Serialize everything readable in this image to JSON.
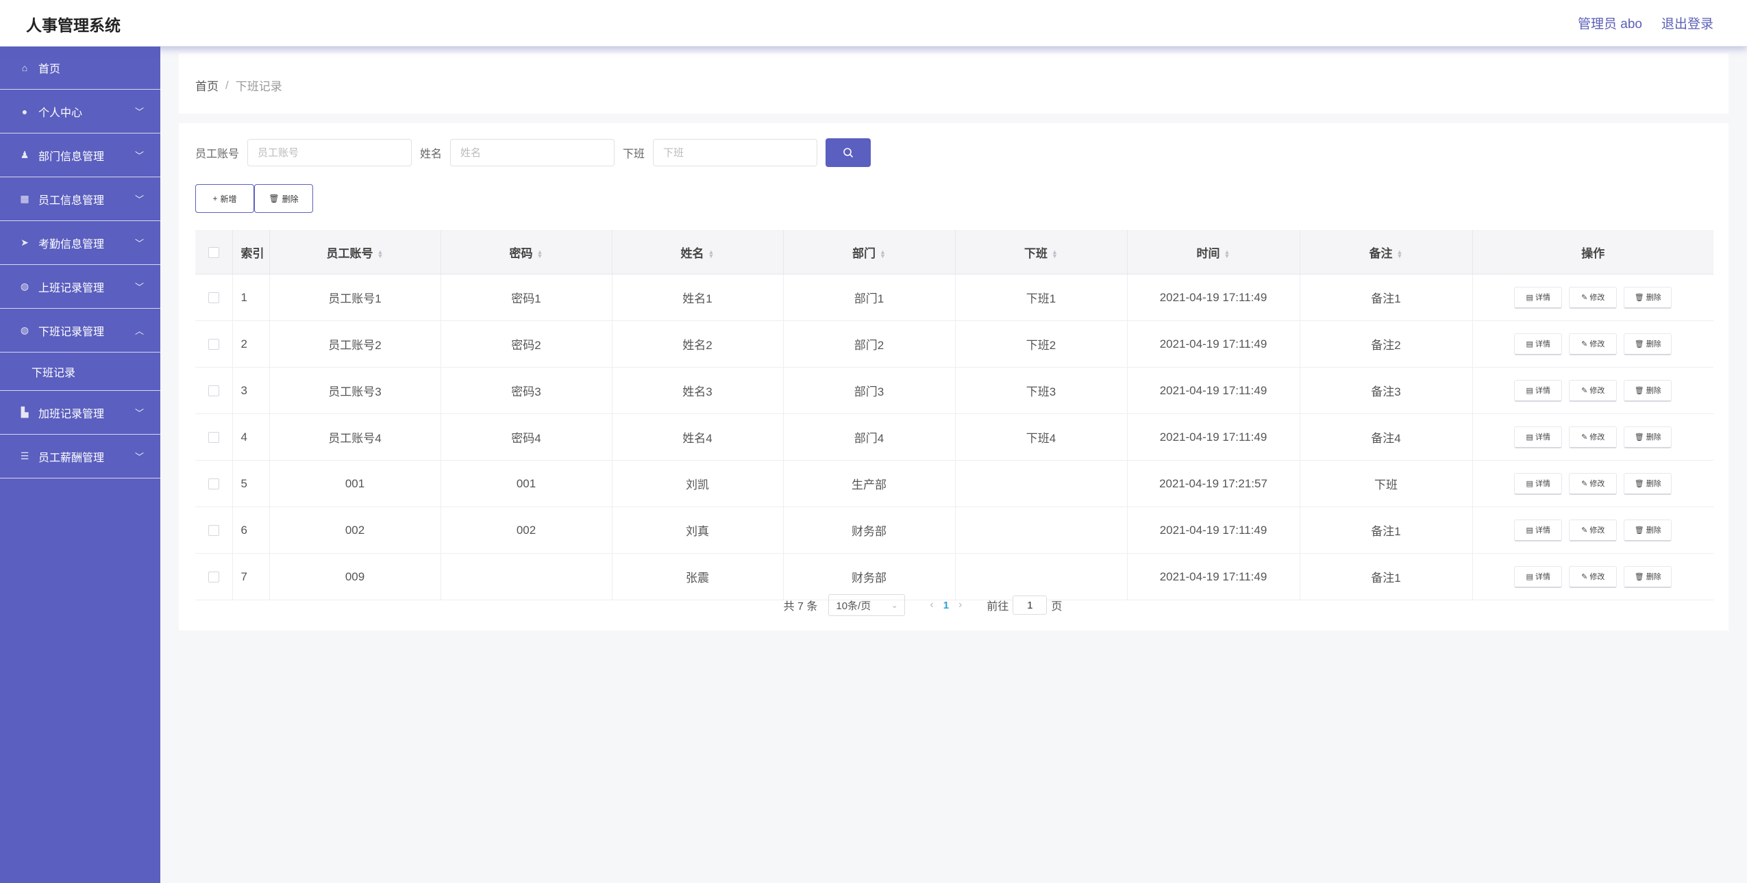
{
  "header": {
    "title": "人事管理系统",
    "user_label": "管理员 abo",
    "logout_label": "退出登录"
  },
  "sidebar": {
    "items": [
      {
        "label": "首页",
        "icon": "home-icon",
        "glyph": "⌂",
        "expandable": false
      },
      {
        "label": "个人中心",
        "icon": "user-icon",
        "glyph": "●",
        "expandable": true
      },
      {
        "label": "部门信息管理",
        "icon": "person-stand-icon",
        "glyph": "♟",
        "expandable": true
      },
      {
        "label": "员工信息管理",
        "icon": "grid-icon",
        "glyph": "▦",
        "expandable": true
      },
      {
        "label": "考勤信息管理",
        "icon": "send-icon",
        "glyph": "➤",
        "expandable": true
      },
      {
        "label": "上班记录管理",
        "icon": "microphone-icon",
        "glyph": "◍",
        "expandable": true
      },
      {
        "label": "下班记录管理",
        "icon": "microphone-icon",
        "glyph": "◍",
        "expandable": true,
        "expanded": true,
        "sub": "下班记录"
      },
      {
        "label": "加班记录管理",
        "icon": "thumbs-up-icon",
        "glyph": "▙",
        "expandable": true
      },
      {
        "label": "员工薪酬管理",
        "icon": "list-icon",
        "glyph": "☰",
        "expandable": true
      }
    ]
  },
  "breadcrumb": {
    "home": "首页",
    "separator": "/",
    "current": "下班记录"
  },
  "search": {
    "account_label": "员工账号",
    "account_placeholder": "员工账号",
    "name_label": "姓名",
    "name_placeholder": "姓名",
    "offwork_label": "下班",
    "offwork_placeholder": "下班"
  },
  "actions": {
    "add_label": "新增",
    "delete_label": "删除"
  },
  "table": {
    "columns": [
      "索引",
      "员工账号",
      "密码",
      "姓名",
      "部门",
      "下班",
      "时间",
      "备注",
      "操作"
    ],
    "rows": [
      {
        "index": "1",
        "account": "员工账号1",
        "password": "密码1",
        "name": "姓名1",
        "dept": "部门1",
        "offwork": "下班1",
        "time": "2021-04-19 17:11:49",
        "note": "备注1"
      },
      {
        "index": "2",
        "account": "员工账号2",
        "password": "密码2",
        "name": "姓名2",
        "dept": "部门2",
        "offwork": "下班2",
        "time": "2021-04-19 17:11:49",
        "note": "备注2"
      },
      {
        "index": "3",
        "account": "员工账号3",
        "password": "密码3",
        "name": "姓名3",
        "dept": "部门3",
        "offwork": "下班3",
        "time": "2021-04-19 17:11:49",
        "note": "备注3"
      },
      {
        "index": "4",
        "account": "员工账号4",
        "password": "密码4",
        "name": "姓名4",
        "dept": "部门4",
        "offwork": "下班4",
        "time": "2021-04-19 17:11:49",
        "note": "备注4"
      },
      {
        "index": "5",
        "account": "001",
        "password": "001",
        "name": "刘凯",
        "dept": "生产部",
        "offwork": "",
        "time": "2021-04-19 17:21:57",
        "note": "下班"
      },
      {
        "index": "6",
        "account": "002",
        "password": "002",
        "name": "刘真",
        "dept": "财务部",
        "offwork": "",
        "time": "2021-04-19 17:11:49",
        "note": "备注1"
      },
      {
        "index": "7",
        "account": "009",
        "password": "",
        "name": "张震",
        "dept": "财务部",
        "offwork": "",
        "time": "2021-04-19 17:11:49",
        "note": "备注1"
      }
    ],
    "row_actions": {
      "detail": "详情",
      "edit": "修改",
      "delete": "删除"
    }
  },
  "pagination": {
    "total_text": "共 7 条",
    "page_size": "10条/页",
    "current_page": "1",
    "goto_prefix": "前往",
    "goto_value": "1",
    "goto_suffix": "页"
  },
  "colors": {
    "accent": "#5b5fbf",
    "link_active": "#2a9fd8"
  }
}
